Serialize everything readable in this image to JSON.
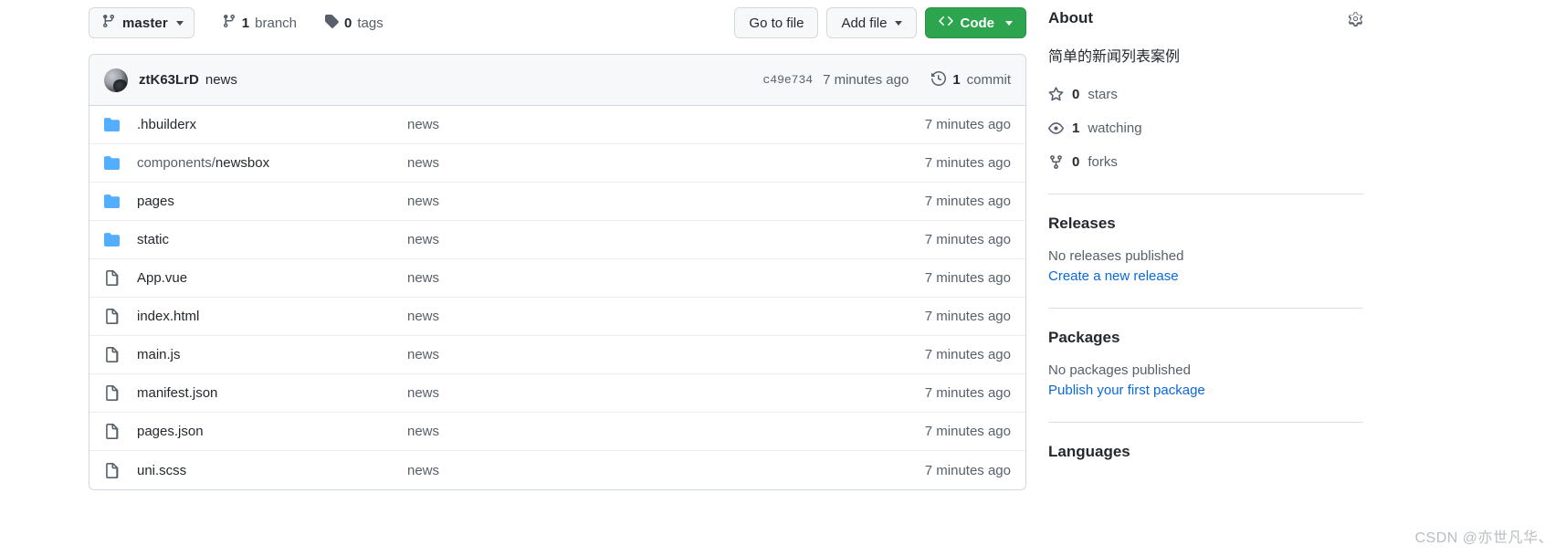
{
  "toolbar": {
    "branch_name": "master",
    "branch_icon": "git-branch-icon",
    "branch_caret_icon": "chevron-down-icon",
    "branches_count": "1",
    "branches_label": "branch",
    "branches_icon": "git-branch-icon",
    "tags_count": "0",
    "tags_label": "tags",
    "tags_icon": "tag-icon",
    "go_to_file_label": "Go to file",
    "add_file_label": "Add file",
    "add_file_caret_icon": "chevron-down-icon",
    "code_label": "Code",
    "code_icon": "code-brackets-icon",
    "code_caret_icon": "chevron-down-icon",
    "code_button_color": "#2da44e"
  },
  "commit_bar": {
    "avatar_icon": "user-avatar",
    "author": "ztK63LrD",
    "message": "news",
    "sha": "c49e734",
    "time": "7 minutes ago",
    "history_icon": "history-icon",
    "commits_count": "1",
    "commits_label": "commit"
  },
  "files": [
    {
      "type": "folder",
      "icon": "folder-icon",
      "name": ".hbuilderx",
      "name_prefix": "",
      "message": "news",
      "time": "7 minutes ago"
    },
    {
      "type": "folder",
      "icon": "folder-icon",
      "name": "newsbox",
      "name_prefix": "components/",
      "message": "news",
      "time": "7 minutes ago"
    },
    {
      "type": "folder",
      "icon": "folder-icon",
      "name": "pages",
      "name_prefix": "",
      "message": "news",
      "time": "7 minutes ago"
    },
    {
      "type": "folder",
      "icon": "folder-icon",
      "name": "static",
      "name_prefix": "",
      "message": "news",
      "time": "7 minutes ago"
    },
    {
      "type": "file",
      "icon": "file-icon",
      "name": "App.vue",
      "name_prefix": "",
      "message": "news",
      "time": "7 minutes ago"
    },
    {
      "type": "file",
      "icon": "file-icon",
      "name": "index.html",
      "name_prefix": "",
      "message": "news",
      "time": "7 minutes ago"
    },
    {
      "type": "file",
      "icon": "file-icon",
      "name": "main.js",
      "name_prefix": "",
      "message": "news",
      "time": "7 minutes ago"
    },
    {
      "type": "file",
      "icon": "file-icon",
      "name": "manifest.json",
      "name_prefix": "",
      "message": "news",
      "time": "7 minutes ago"
    },
    {
      "type": "file",
      "icon": "file-icon",
      "name": "pages.json",
      "name_prefix": "",
      "message": "news",
      "time": "7 minutes ago"
    },
    {
      "type": "file",
      "icon": "file-icon",
      "name": "uni.scss",
      "name_prefix": "",
      "message": "news",
      "time": "7 minutes ago"
    }
  ],
  "sidebar": {
    "about": {
      "title": "About",
      "gear_icon": "gear-icon",
      "description": "简单的新闻列表案例"
    },
    "stats": [
      {
        "icon": "star-icon",
        "count": "0",
        "label": "stars"
      },
      {
        "icon": "eye-icon",
        "count": "1",
        "label": "watching"
      },
      {
        "icon": "fork-icon",
        "count": "0",
        "label": "forks"
      }
    ],
    "releases": {
      "title": "Releases",
      "empty": "No releases published",
      "link": "Create a new release"
    },
    "packages": {
      "title": "Packages",
      "empty": "No packages published",
      "link": "Publish your first package"
    },
    "languages": {
      "title": "Languages"
    }
  },
  "watermark": "CSDN @亦世凡华、",
  "colors": {
    "folder_blue": "#54aeff",
    "link_blue": "#0969da",
    "muted": "#57606a"
  }
}
